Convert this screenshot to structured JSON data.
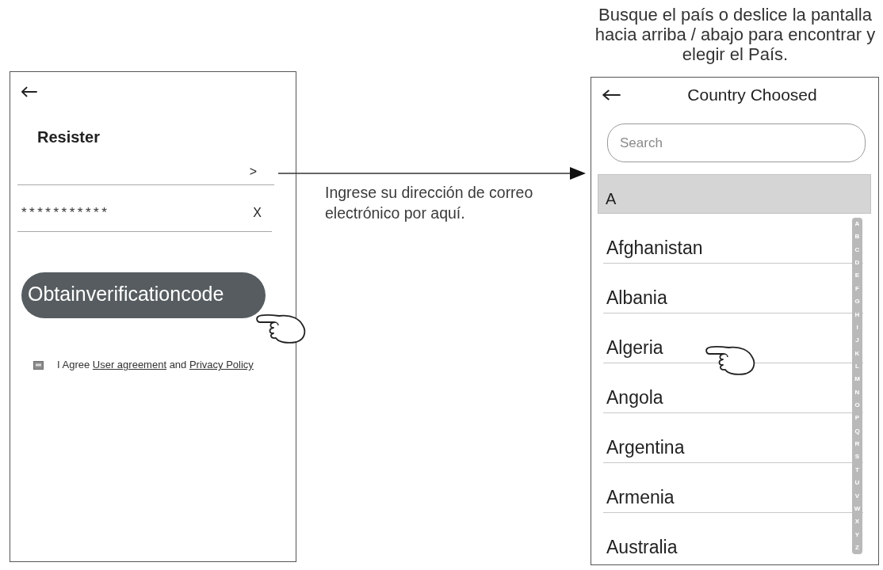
{
  "register_screen": {
    "title": "Resister",
    "email_field": {
      "action": ">"
    },
    "password_field": {
      "value": "***********",
      "clear": "X"
    },
    "button": "Obtainverificationcode",
    "agreement": {
      "checked": true,
      "parts": [
        {
          "kind": "text",
          "text": "I Agree "
        },
        {
          "kind": "link",
          "text": "User agreement"
        },
        {
          "kind": "text",
          "text": " and "
        },
        {
          "kind": "link",
          "text": "Privacy Policy"
        }
      ]
    }
  },
  "email_hint": "Ingrese su dirección de correo electrónico por aquí.",
  "country_caption": "Busque el país o deslice la pantalla hacia arriba / abajo para encontrar y elegir el País.",
  "country_screen": {
    "title": "Country Choosed",
    "search": {
      "placeholder": "Search"
    },
    "sections": [
      {
        "letter": "A",
        "countries": [
          "Afghanistan",
          "Albania",
          "Algeria",
          "Angola",
          "Argentina",
          "Armenia",
          "Australia"
        ]
      }
    ],
    "index_letters": [
      "A",
      "B",
      "C",
      "D",
      "E",
      "F",
      "G",
      "H",
      "I",
      "J",
      "K",
      "L",
      "M",
      "N",
      "O",
      "P",
      "Q",
      "R",
      "S",
      "T",
      "U",
      "V",
      "W",
      "X",
      "Y",
      "Z"
    ]
  }
}
